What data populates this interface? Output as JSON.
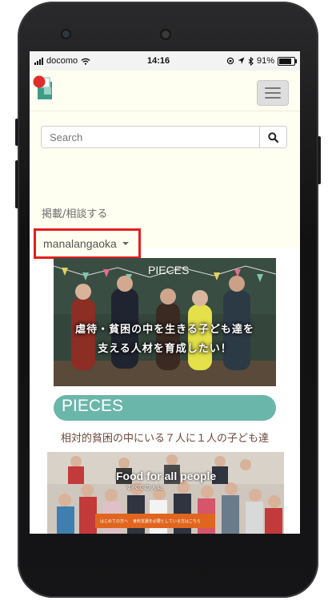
{
  "status_bar": {
    "carrier": "docomo",
    "time": "14:16",
    "battery": "91%"
  },
  "header": {
    "logo_icon": "pieces-logo-icon",
    "menu_icon": "hamburger-icon"
  },
  "search": {
    "placeholder": "Search",
    "icon": "search-icon"
  },
  "nav": {
    "post_link": "掲載/相談する",
    "username": "manalangaoka"
  },
  "banner_main": {
    "board_text": "PIECES",
    "caption_line1": "虐待・貧困の中を生きる子ども達を",
    "caption_line2": "支える人材を育成したい！"
  },
  "project": {
    "title": "PIECES",
    "tagline": "相対的貧困の中にいる７人に１人の子ども達"
  },
  "banner_second": {
    "title": "Food for all people",
    "subtitle": "すべての人に",
    "strip_left": "はじめての方へ",
    "strip_right": "食料支援を必要としている方はこちら"
  },
  "colors": {
    "highlight": "#e41e1e",
    "accent": "#6bb6aa",
    "top_bg": "#fffff1"
  }
}
